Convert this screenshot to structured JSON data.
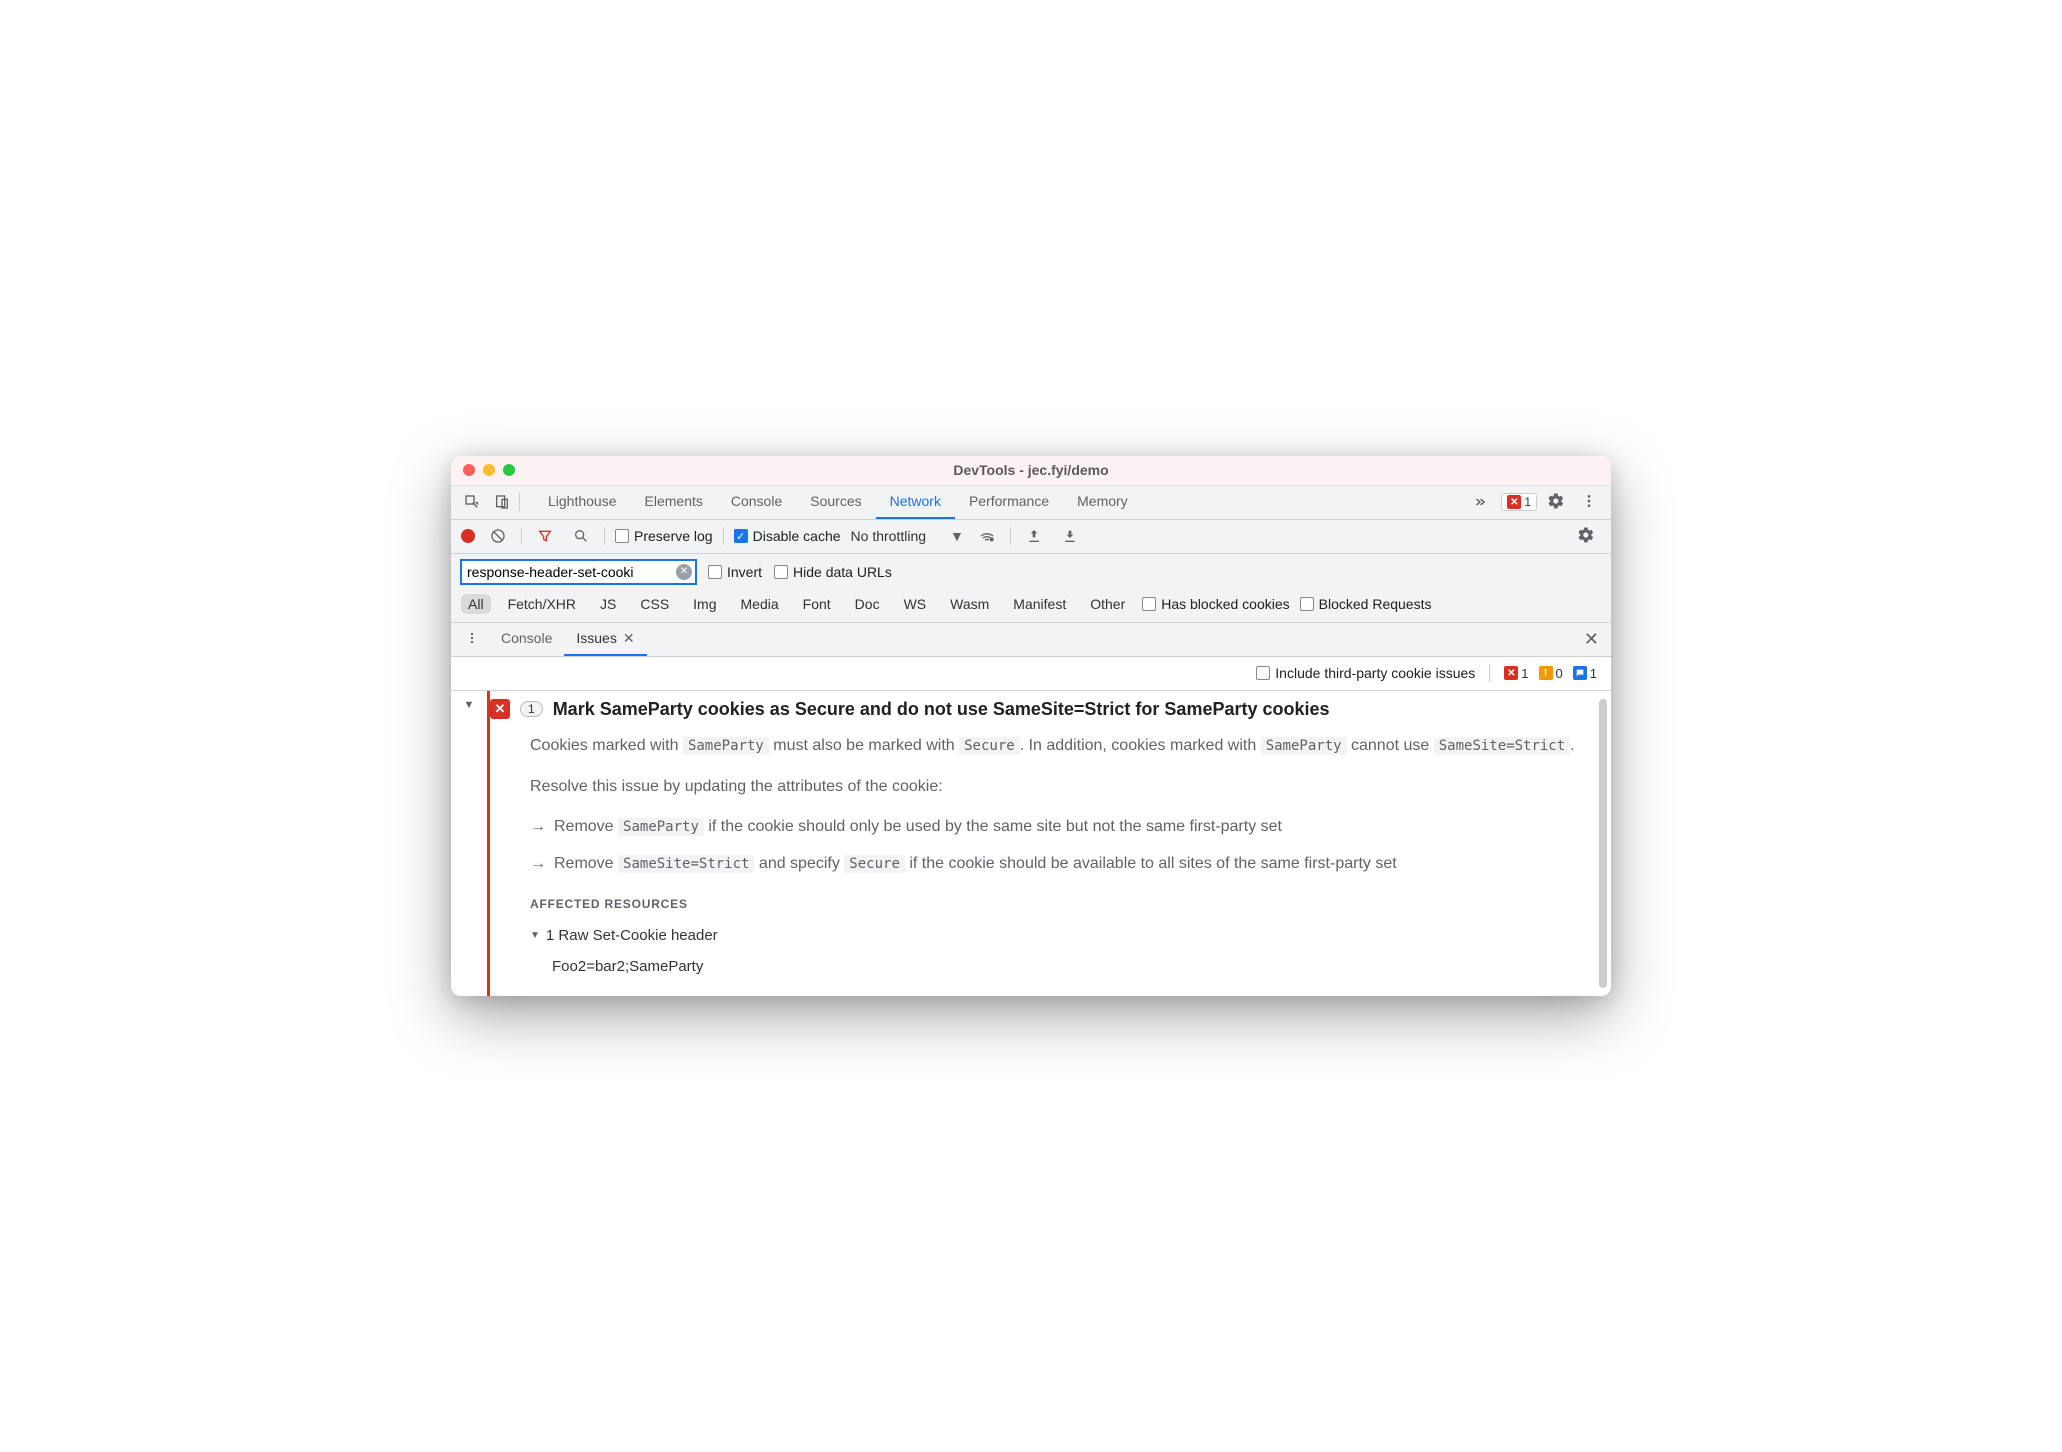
{
  "window": {
    "title": "DevTools - jec.fyi/demo"
  },
  "tabs": {
    "items": [
      "Lighthouse",
      "Elements",
      "Console",
      "Sources",
      "Network",
      "Performance",
      "Memory"
    ],
    "active": "Network",
    "error_count": "1"
  },
  "net_toolbar": {
    "preserve_log": "Preserve log",
    "disable_cache": "Disable cache",
    "throttling": "No throttling"
  },
  "filter": {
    "value": "response-header-set-cooki",
    "invert": "Invert",
    "hide_urls": "Hide data URLs"
  },
  "types": {
    "items": [
      "All",
      "Fetch/XHR",
      "JS",
      "CSS",
      "Img",
      "Media",
      "Font",
      "Doc",
      "WS",
      "Wasm",
      "Manifest",
      "Other"
    ],
    "active": "All",
    "blocked_cookies": "Has blocked cookies",
    "blocked_requests": "Blocked Requests"
  },
  "drawer": {
    "tabs": [
      "Console",
      "Issues"
    ],
    "active": "Issues"
  },
  "issues_toolbar": {
    "include_third_party": "Include third-party cookie issues",
    "counts": {
      "error": "1",
      "warning": "0",
      "info": "1"
    }
  },
  "issue": {
    "count": "1",
    "title": "Mark SameParty cookies as Secure and do not use SameSite=Strict for SameParty cookies",
    "p1_a": "Cookies marked with ",
    "p1_code1": "SameParty",
    "p1_b": " must also be marked with ",
    "p1_code2": "Secure",
    "p1_c": ". In addition, cookies marked with ",
    "p1_code3": "SameParty",
    "p1_d": " cannot use ",
    "p1_code4": "SameSite=Strict",
    "p1_e": ".",
    "p2": "Resolve this issue by updating the attributes of the cookie:",
    "b1_a": "Remove ",
    "b1_code": "SameParty",
    "b1_b": " if the cookie should only be used by the same site but not the same first-party set",
    "b2_a": "Remove ",
    "b2_code1": "SameSite=Strict",
    "b2_b": " and specify ",
    "b2_code2": "Secure",
    "b2_c": " if the cookie should be available to all sites of the same first-party set",
    "affected_heading": "Affected Resources",
    "affected_row": "1 Raw Set-Cookie header",
    "cookie_value": "Foo2=bar2;SameParty"
  }
}
